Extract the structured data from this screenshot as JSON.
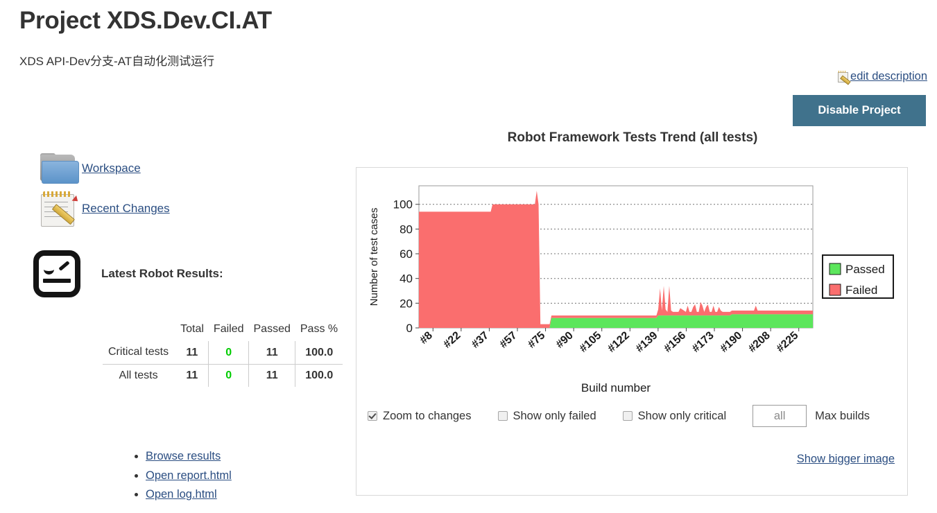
{
  "header": {
    "title": "Project XDS.Dev.CI.AT",
    "subtitle": "XDS API-Dev分支-AT自动化测试运行",
    "edit_description_label": "edit description",
    "disable_project_label": "Disable Project"
  },
  "sidebar": {
    "items": [
      {
        "label": "Workspace",
        "icon": "folder-icon"
      },
      {
        "label": "Recent Changes",
        "icon": "notepad-pencil-icon"
      }
    ],
    "robot_heading": "Latest Robot Results:",
    "robot_icon": "robot-face-icon"
  },
  "results_table": {
    "corner_header": "",
    "headers": [
      "Total",
      "Failed",
      "Passed",
      "Pass %"
    ],
    "rows": [
      {
        "label": "Critical tests",
        "total": "11",
        "failed": "0",
        "passed": "11",
        "pass_pct": "100.0"
      },
      {
        "label": "All tests",
        "total": "11",
        "failed": "0",
        "passed": "11",
        "pass_pct": "100.0"
      }
    ],
    "failed_zero_color": "#00cc00"
  },
  "result_links": [
    "Browse results",
    "Open report.html",
    "Open log.html"
  ],
  "chart_panel": {
    "title": "Robot Framework Tests Trend (all tests)",
    "controls": {
      "zoom_to_changes": {
        "label": "Zoom to changes",
        "checked": true
      },
      "show_only_failed": {
        "label": "Show only failed",
        "checked": false
      },
      "show_only_critical": {
        "label": "Show only critical",
        "checked": false
      },
      "max_builds_value": "all",
      "max_builds_label": "Max builds"
    },
    "show_bigger_image_label": "Show bigger image"
  },
  "chart_data": {
    "type": "area",
    "title": "Robot Framework Tests Trend (all tests)",
    "xlabel": "Build number",
    "ylabel": "Number of test cases",
    "ylim": [
      0,
      115
    ],
    "yticks": [
      0,
      20,
      40,
      60,
      80,
      100
    ],
    "grid": true,
    "legend_position": "right-outside",
    "colors": {
      "passed": "#5ce65c",
      "failed": "#fa6e6e"
    },
    "legend": [
      {
        "name": "Passed",
        "color": "#5ce65c"
      },
      {
        "name": "Failed",
        "color": "#fa6e6e"
      }
    ],
    "tick_labels": [
      "#8",
      "#22",
      "#37",
      "#57",
      "#75",
      "#90",
      "#105",
      "#122",
      "#139",
      "#156",
      "#173",
      "#190",
      "#208",
      "#225"
    ],
    "series": [
      {
        "name": "Failed",
        "values": [
          94,
          94,
          94,
          94,
          94,
          94,
          94,
          94,
          94,
          94,
          94,
          94,
          94,
          94,
          94,
          94,
          94,
          94,
          94,
          94,
          94,
          94,
          94,
          94,
          94,
          94,
          94,
          94,
          94,
          94,
          94,
          94,
          94,
          94,
          94,
          94,
          94,
          94,
          94,
          94,
          100,
          100,
          100,
          100,
          100,
          100,
          100,
          100,
          100,
          100,
          100,
          100,
          100,
          100,
          100,
          100,
          100,
          100,
          100,
          100,
          100,
          100,
          100,
          100,
          111,
          100,
          3,
          3,
          3,
          3,
          3,
          3,
          2,
          2,
          2,
          2,
          2,
          2,
          2,
          2,
          2,
          2,
          2,
          2,
          2,
          2,
          2,
          2,
          2,
          2,
          2,
          2,
          2,
          2,
          2,
          2,
          2,
          2,
          2,
          2,
          2,
          2,
          2,
          2,
          2,
          2,
          2,
          2,
          2,
          2,
          2,
          2,
          2,
          2,
          2,
          2,
          2,
          2,
          2,
          2,
          2,
          2,
          2,
          2,
          2,
          2,
          2,
          2,
          2,
          2,
          5,
          22,
          4,
          24,
          5,
          3,
          24,
          4,
          3,
          3,
          3,
          3,
          6,
          5,
          4,
          3,
          8,
          3,
          3,
          7,
          9,
          3,
          3,
          11,
          8,
          3,
          7,
          9,
          3,
          3,
          8,
          3,
          3,
          7,
          4,
          3,
          3,
          3,
          3,
          3,
          3,
          3,
          3,
          3,
          3,
          3,
          3,
          3,
          3,
          3,
          3,
          3,
          3,
          7,
          3,
          3,
          3,
          3,
          3,
          3,
          3,
          3,
          3,
          3,
          3,
          3,
          3,
          3,
          3,
          3,
          3,
          3,
          3,
          3,
          3,
          3,
          3,
          3,
          3,
          3,
          3,
          3,
          3,
          3,
          3
        ]
      },
      {
        "name": "Passed",
        "values": [
          0,
          0,
          0,
          0,
          0,
          0,
          0,
          0,
          0,
          0,
          0,
          0,
          0,
          0,
          0,
          0,
          0,
          0,
          0,
          0,
          0,
          0,
          0,
          0,
          0,
          0,
          0,
          0,
          0,
          0,
          0,
          0,
          0,
          0,
          0,
          0,
          0,
          0,
          0,
          0,
          0,
          0,
          0,
          0,
          0,
          0,
          0,
          0,
          0,
          0,
          0,
          0,
          0,
          0,
          0,
          0,
          0,
          0,
          0,
          0,
          0,
          0,
          0,
          0,
          0,
          0,
          0,
          0,
          0,
          0,
          0,
          0,
          8,
          8,
          8,
          8,
          8,
          8,
          8,
          8,
          8,
          8,
          8,
          8,
          8,
          8,
          8,
          8,
          8,
          8,
          8,
          8,
          8,
          8,
          8,
          8,
          8,
          8,
          8,
          8,
          8,
          8,
          8,
          8,
          8,
          8,
          8,
          8,
          8,
          8,
          8,
          8,
          8,
          8,
          8,
          8,
          8,
          8,
          8,
          8,
          8,
          8,
          8,
          8,
          8,
          8,
          8,
          8,
          8,
          8,
          10,
          10,
          10,
          10,
          10,
          10,
          10,
          10,
          10,
          10,
          10,
          10,
          10,
          10,
          10,
          10,
          10,
          10,
          10,
          10,
          10,
          10,
          10,
          10,
          10,
          10,
          10,
          10,
          10,
          10,
          10,
          10,
          10,
          10,
          10,
          10,
          10,
          10,
          10,
          10,
          11,
          11,
          11,
          11,
          11,
          11,
          11,
          11,
          11,
          11,
          11,
          11,
          11,
          11,
          11,
          11,
          11,
          11,
          11,
          11,
          11,
          11,
          11,
          11,
          11,
          11,
          11,
          11,
          11,
          11,
          11,
          11,
          11,
          11,
          11,
          11,
          11,
          11,
          11,
          11,
          11,
          11,
          11,
          11,
          11
        ]
      }
    ]
  }
}
